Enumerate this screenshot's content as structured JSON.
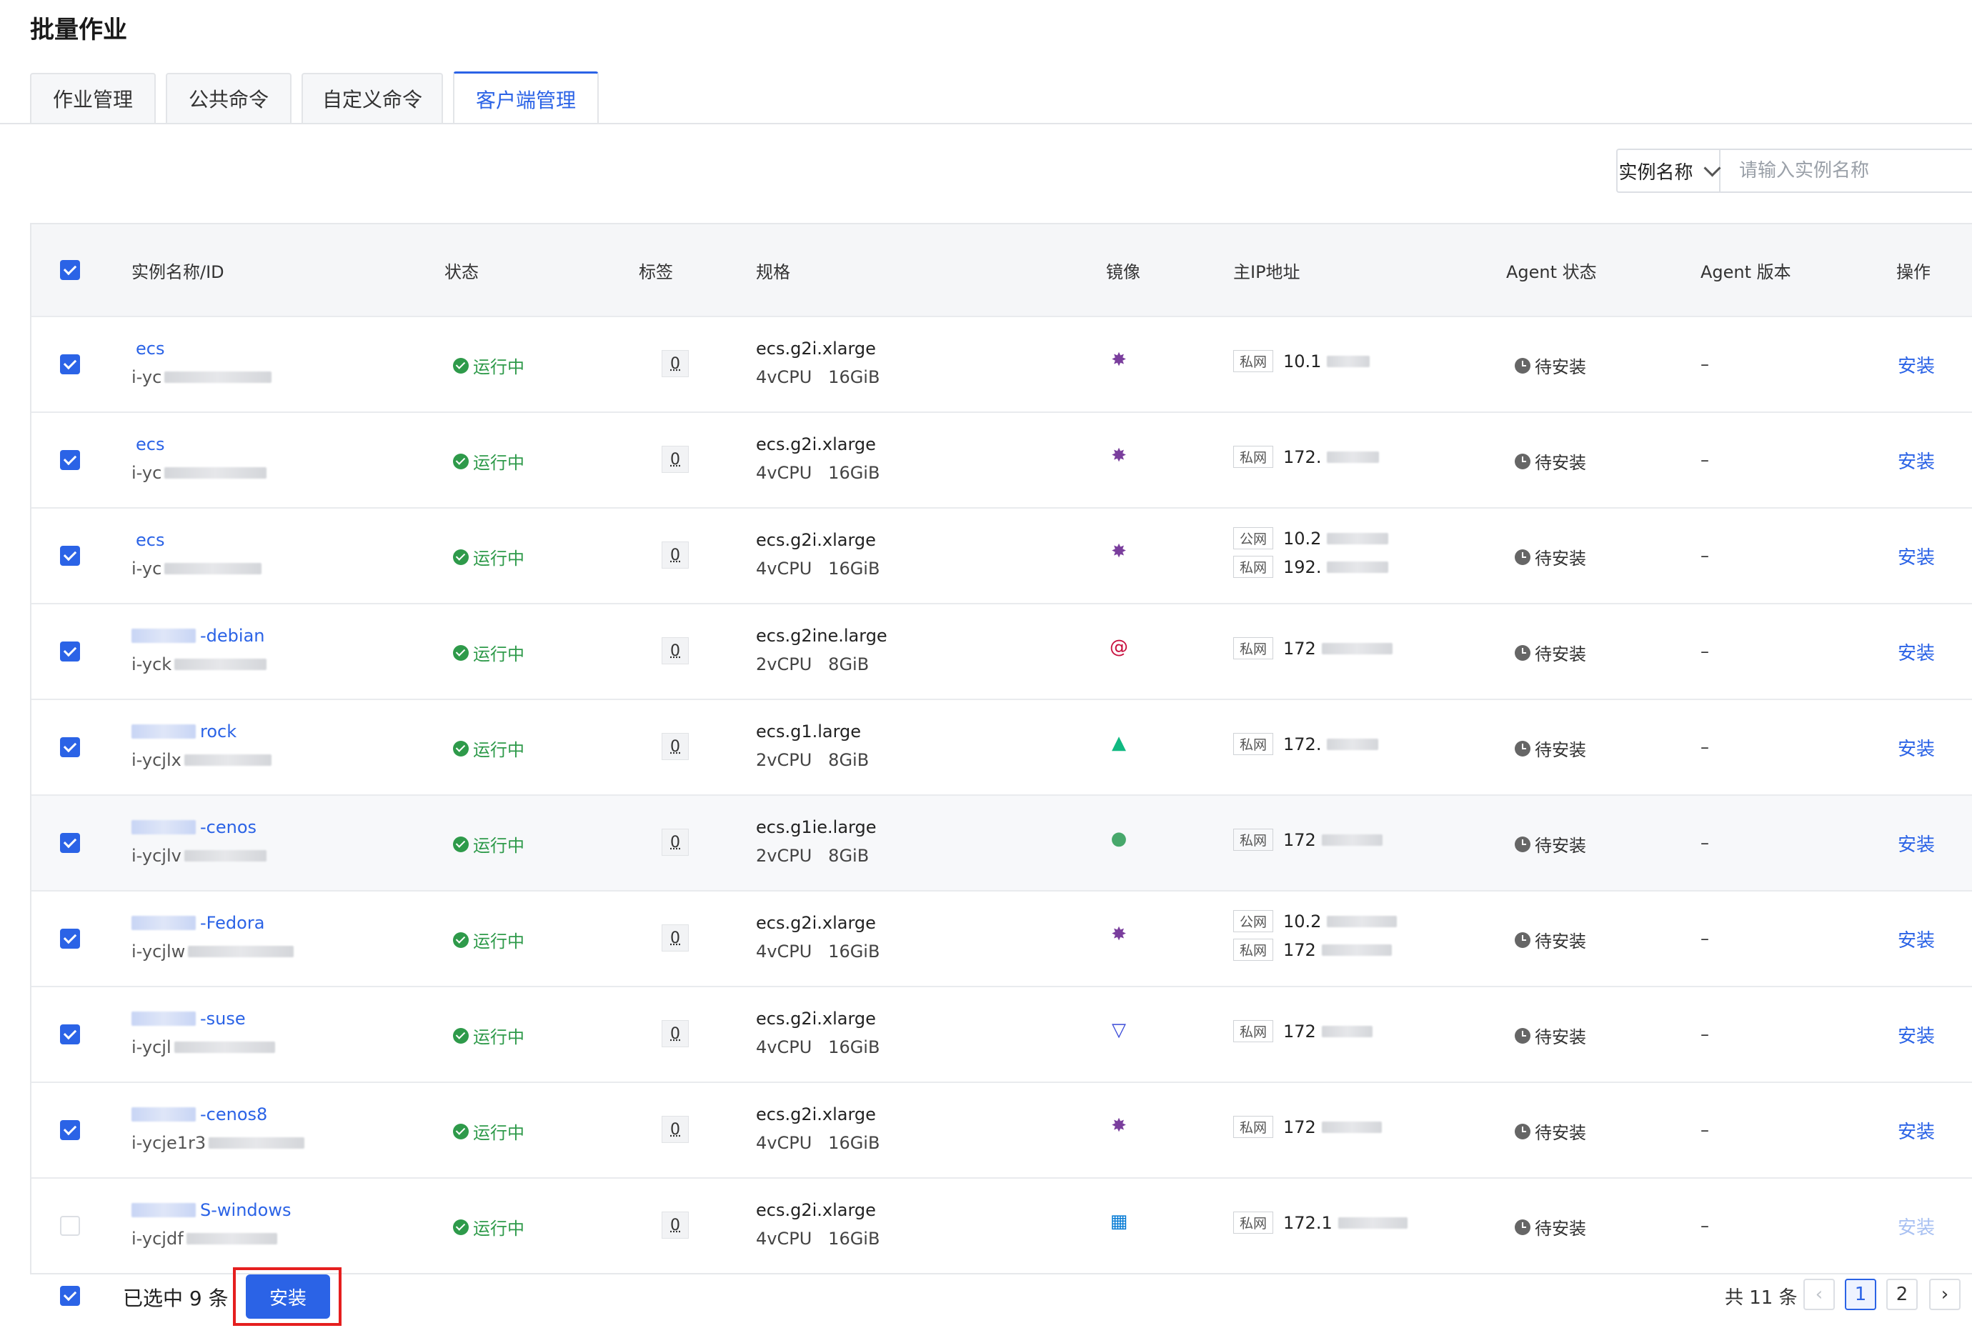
{
  "title": "批量作业",
  "tabs": [
    {
      "label": "作业管理",
      "active": false
    },
    {
      "label": "公共命令",
      "active": false
    },
    {
      "label": "自定义命令",
      "active": false
    },
    {
      "label": "客户端管理",
      "active": true
    }
  ],
  "search": {
    "field": "实例名称",
    "placeholder": "请输入实例名称"
  },
  "columns": [
    "实例名称/ID",
    "状态",
    "标签",
    "规格",
    "镜像",
    "主IP地址",
    "Agent 状态",
    "Agent 版本",
    "操作"
  ],
  "rows": [
    {
      "name": "ecs",
      "id": "i-yc",
      "status": "运行中",
      "tag": "0",
      "spec": "ecs.g2i.xlarge",
      "cpu": "4vCPU",
      "mem": "16GiB",
      "image": "centos-icon",
      "ips": [
        {
          "type": "私网",
          "ip": "10.1"
        }
      ],
      "agent_status": "待安装",
      "agent_version": "–",
      "op": "安装",
      "checked": true
    },
    {
      "name": "ecs",
      "id": "i-yc",
      "status": "运行中",
      "tag": "0",
      "spec": "ecs.g2i.xlarge",
      "cpu": "4vCPU",
      "mem": "16GiB",
      "image": "centos-icon",
      "ips": [
        {
          "type": "私网",
          "ip": "172."
        }
      ],
      "agent_status": "待安装",
      "agent_version": "–",
      "op": "安装",
      "checked": true
    },
    {
      "name": "ecs",
      "id": "i-yc",
      "status": "运行中",
      "tag": "0",
      "spec": "ecs.g2i.xlarge",
      "cpu": "4vCPU",
      "mem": "16GiB",
      "image": "centos-icon",
      "ips": [
        {
          "type": "公网",
          "ip": "10.2"
        },
        {
          "type": "私网",
          "ip": "192."
        }
      ],
      "agent_status": "待安装",
      "agent_version": "–",
      "op": "安装",
      "checked": true
    },
    {
      "name": "-debian",
      "id": "i-yck",
      "status": "运行中",
      "tag": "0",
      "spec": "ecs.g2ine.large",
      "cpu": "2vCPU",
      "mem": "8GiB",
      "image": "debian-icon",
      "ips": [
        {
          "type": "私网",
          "ip": "172"
        }
      ],
      "agent_status": "待安装",
      "agent_version": "–",
      "op": "安装",
      "checked": true
    },
    {
      "name": "rock",
      "id": "i-ycjlx",
      "status": "运行中",
      "tag": "0",
      "spec": "ecs.g1.large",
      "cpu": "2vCPU",
      "mem": "8GiB",
      "image": "rocky-icon",
      "ips": [
        {
          "type": "私网",
          "ip": "172."
        }
      ],
      "agent_status": "待安装",
      "agent_version": "–",
      "op": "安装",
      "checked": true
    },
    {
      "name": "-cenos",
      "id": "i-ycjlv",
      "status": "运行中",
      "tag": "0",
      "spec": "ecs.g1ie.large",
      "cpu": "2vCPU",
      "mem": "8GiB",
      "image": "opensuse-icon",
      "ips": [
        {
          "type": "私网",
          "ip": "172"
        }
      ],
      "agent_status": "待安装",
      "agent_version": "–",
      "op": "安装",
      "checked": true,
      "highlight": true
    },
    {
      "name": "-Fedora",
      "id": "i-ycjlw",
      "status": "运行中",
      "tag": "0",
      "spec": "ecs.g2i.xlarge",
      "cpu": "4vCPU",
      "mem": "16GiB",
      "image": "centos-icon",
      "ips": [
        {
          "type": "公网",
          "ip": "10.2"
        },
        {
          "type": "私网",
          "ip": "172"
        }
      ],
      "agent_status": "待安装",
      "agent_version": "–",
      "op": "安装",
      "checked": true
    },
    {
      "name": "-suse",
      "id": "i-ycjl",
      "status": "运行中",
      "tag": "0",
      "spec": "ecs.g2i.xlarge",
      "cpu": "4vCPU",
      "mem": "16GiB",
      "image": "veLinux-icon",
      "ips": [
        {
          "type": "私网",
          "ip": "172"
        }
      ],
      "agent_status": "待安装",
      "agent_version": "–",
      "op": "安装",
      "checked": true
    },
    {
      "name": "-cenos8",
      "id": "i-ycje1r3",
      "status": "运行中",
      "tag": "0",
      "spec": "ecs.g2i.xlarge",
      "cpu": "4vCPU",
      "mem": "16GiB",
      "image": "centos-icon",
      "ips": [
        {
          "type": "私网",
          "ip": "172"
        }
      ],
      "agent_status": "待安装",
      "agent_version": "–",
      "op": "安装",
      "checked": true
    },
    {
      "name": "S-windows",
      "id": "i-ycjdf",
      "status": "运行中",
      "tag": "0",
      "spec": "ecs.g2i.xlarge",
      "cpu": "4vCPU",
      "mem": "16GiB",
      "image": "windows-icon",
      "ips": [
        {
          "type": "私网",
          "ip": "172.1"
        }
      ],
      "agent_status": "待安装",
      "agent_version": "–",
      "op": "安装",
      "checked": false,
      "disabled": true
    }
  ],
  "footer": {
    "selected": "已选中 9 条",
    "install": "安装",
    "total": "共 11 条",
    "pages": [
      "1",
      "2"
    ],
    "current_page": "1"
  },
  "colors": {
    "primary": "#2b63e6",
    "success": "#2e9a4a",
    "highlight_border": "#e51f1f"
  }
}
